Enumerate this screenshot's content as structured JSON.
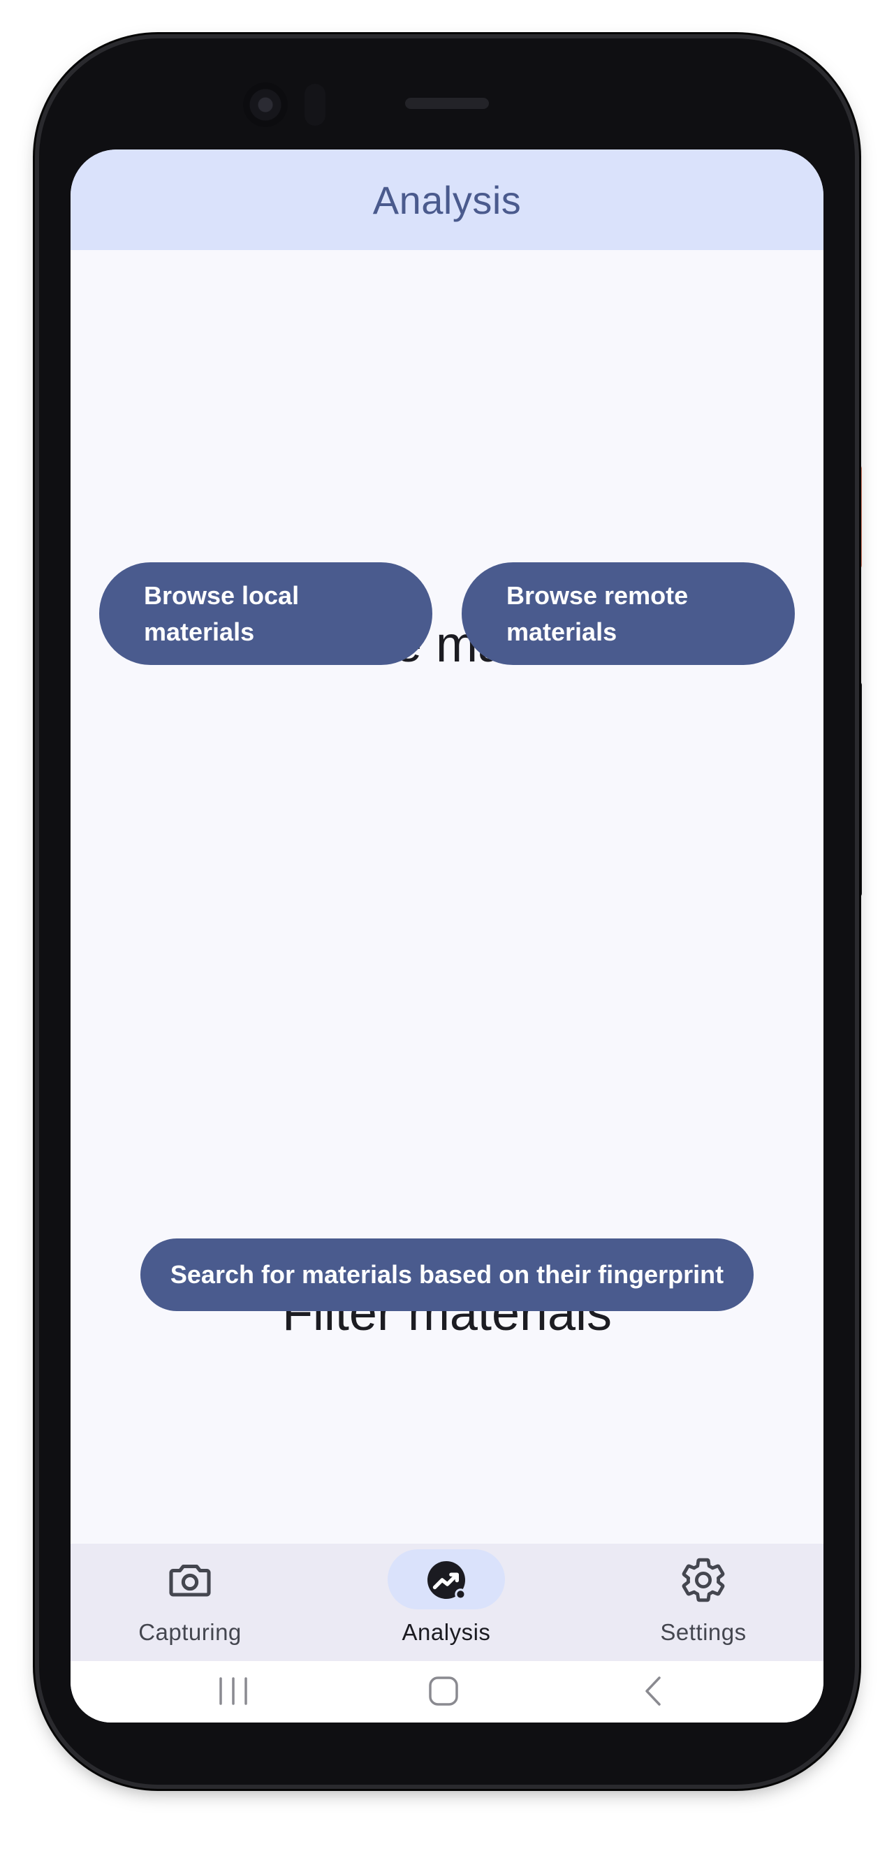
{
  "app_bar": {
    "title": "Analysis"
  },
  "browse_section": {
    "title": "Browse materials",
    "local_button_label": "Browse local materials",
    "remote_button_label": "Browse remote materials"
  },
  "filter_section": {
    "title": "Filter materials",
    "search_button_label": "Search for materials based on their fingerprint"
  },
  "bottom_nav": {
    "items": [
      {
        "label": "Capturing",
        "icon": "camera-icon",
        "active": false
      },
      {
        "label": "Analysis",
        "icon": "analytics-icon",
        "active": true
      },
      {
        "label": "Settings",
        "icon": "gear-icon",
        "active": false
      }
    ]
  },
  "system_nav": {
    "recents_icon": "recents-icon",
    "home_icon": "home-icon",
    "back_icon": "back-icon"
  },
  "colors": {
    "app_bar_bg": "#dae2fb",
    "primary": "#4a5b8e",
    "screen_bg": "#f8f8fd",
    "nav_bg": "#ebeaf4",
    "active_indicator": "#dae2fb"
  }
}
